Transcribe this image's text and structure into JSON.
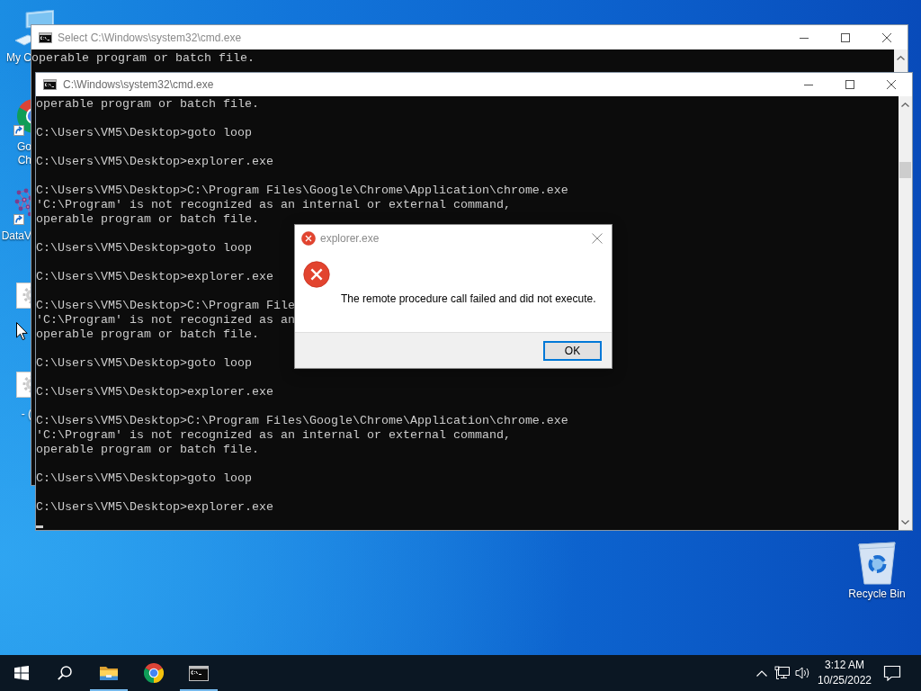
{
  "desktop_icons": [
    {
      "kind": "computer",
      "shortcut": false,
      "label_lines": [
        "My C"
      ]
    },
    {
      "kind": "chrome",
      "shortcut": true,
      "label_lines": [
        "Go",
        "Ch"
      ]
    },
    {
      "kind": "dataviz",
      "shortcut": true,
      "label_lines": [
        "DataV"
      ]
    },
    {
      "kind": "settings_file",
      "shortcut": false
    },
    {
      "kind": "settings_file",
      "shortcut": false,
      "label_lines": [
        "- ("
      ]
    }
  ],
  "recycle_bin": {
    "label": "Recycle Bin"
  },
  "windows": [
    {
      "title": "Select C:\\Windows\\system32\\cmd.exe",
      "cursor": false,
      "output": [
        [
          "operable program or batch file."
        ]
      ]
    },
    {
      "title": "C:\\Windows\\system32\\cmd.exe",
      "cursor": true,
      "output": [
        [
          "operable program or batch file."
        ],
        [
          "C:\\Users\\VM5\\Desktop>goto loop"
        ],
        [
          "C:\\Users\\VM5\\Desktop>explorer.exe"
        ],
        [
          "C:\\Users\\VM5\\Desktop>C:\\Program Files\\Google\\Chrome\\Application\\chrome.exe",
          "'C:\\Program' is not recognized as an internal or external command,",
          "operable program or batch file."
        ],
        [
          "C:\\Users\\VM5\\Desktop>goto loop"
        ],
        [
          "C:\\Users\\VM5\\Desktop>explorer.exe"
        ],
        [
          "C:\\Users\\VM5\\Desktop>C:\\Program File",
          "'C:\\Program' is not recognized as an",
          "operable program or batch file."
        ],
        [
          "C:\\Users\\VM5\\Desktop>goto loop"
        ],
        [
          "C:\\Users\\VM5\\Desktop>explorer.exe"
        ],
        [
          "C:\\Users\\VM5\\Desktop>C:\\Program Files\\Google\\Chrome\\Application\\chrome.exe",
          "'C:\\Program' is not recognized as an internal or external command,",
          "operable program or batch file."
        ],
        [
          "C:\\Users\\VM5\\Desktop>goto loop"
        ],
        [
          "C:\\Users\\VM5\\Desktop>explorer.exe"
        ]
      ]
    }
  ],
  "dialog": {
    "title": "explorer.exe",
    "message": "The remote procedure call failed and did not execute.",
    "buttons": [
      {
        "label": "OK",
        "default": true
      }
    ]
  },
  "taskbar": {
    "apps": [
      {
        "kind": "file_explorer",
        "running": true
      },
      {
        "kind": "chrome",
        "running": false
      },
      {
        "kind": "cmd",
        "running": true
      }
    ],
    "clock": {
      "time": "3:12 AM",
      "date": "10/25/2022"
    }
  }
}
